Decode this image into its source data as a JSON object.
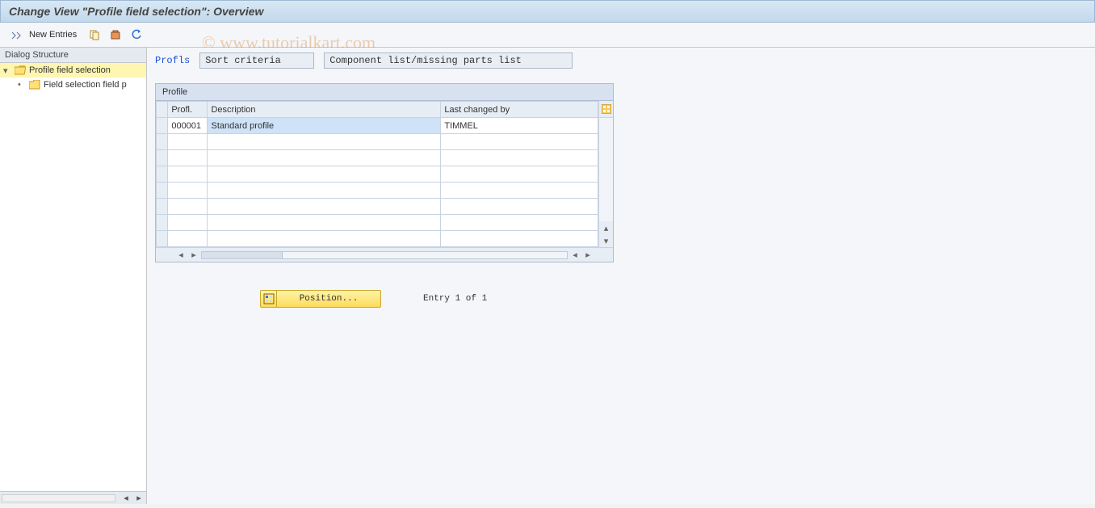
{
  "titlebar": "Change View \"Profile field selection\": Overview",
  "toolbar": {
    "new_entries": "New Entries"
  },
  "watermark": "© www.tutorialkart.com",
  "sidebar": {
    "title": "Dialog Structure",
    "nodes": [
      {
        "label": "Profile field selection",
        "selected": true,
        "expanded": true
      },
      {
        "label": "Field selection field p",
        "selected": false
      }
    ]
  },
  "fields": {
    "profls_label": "Profls",
    "sort_criteria": "Sort criteria",
    "component_list": "Component list/missing parts list"
  },
  "grid": {
    "title": "Profile",
    "columns": {
      "profl": "Profl.",
      "desc": "Description",
      "changed": "Last changed by"
    },
    "rows": [
      {
        "profl": "000001",
        "desc": "Standard profile",
        "changed": "TIMMEL"
      }
    ]
  },
  "footer": {
    "position_label": "Position...",
    "entry_text": "Entry 1 of 1"
  }
}
